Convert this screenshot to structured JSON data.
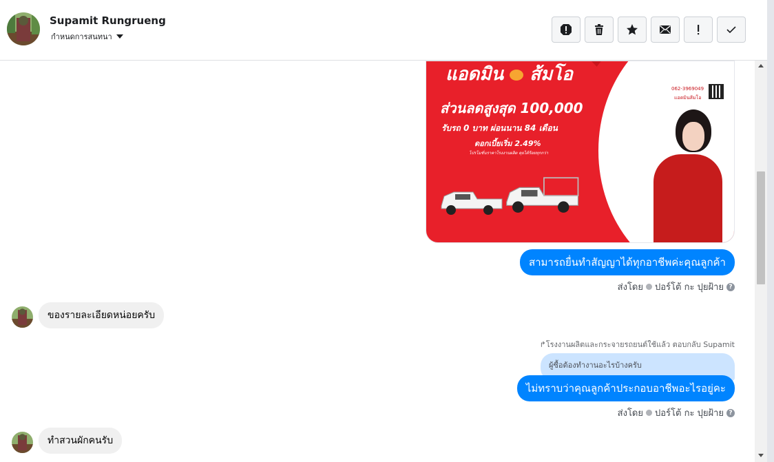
{
  "header": {
    "contact_name": "Supamit Rungrueng",
    "assign_label": "กำหนดการสนทนา",
    "toolbar": {
      "spam": "spam-icon",
      "delete": "trash-icon",
      "star": "star-icon",
      "mark_unread": "envelope-icon",
      "follow_up": "exclamation-icon",
      "done": "check-icon"
    }
  },
  "ad": {
    "brand": "แอดมิน",
    "brand2": "ส้มโอ",
    "headline": "ส่วนลดสูงสุด 100,000",
    "line2": "รับรถ 0 บาท ผ่อนนาน 84 เดือน",
    "line3": "ดอกเบี้ยเริ่ม 2.49%",
    "fine_print": "โปรโมชั่นราคาโรงงานผลิต คุยได้ร้อยทุกกว่า",
    "phone": "062-3969049",
    "contact_name": "แอดมินส้มโอ"
  },
  "messages": [
    {
      "type": "outgoing",
      "text": "สามารถยื่นทำสัญญาได้ทุกอาชีพค่ะคุณลูกค้า"
    },
    {
      "type": "sent_by",
      "prefix": "ส่งโดย",
      "name": "ปอร์โต้ กะ ปุยฝ้าย"
    },
    {
      "type": "incoming",
      "text": "ของรายละเอียดหน่อยครับ"
    },
    {
      "type": "reply_label",
      "text": "โรงงานผลิตและกระจายรถยนต์ใช้แล้ว ตอบกลับ Supamit"
    },
    {
      "type": "quoted",
      "text": "ผู้ซื้อต้องทำงานอะไรบ้างครับ"
    },
    {
      "type": "outgoing",
      "text": "ไม่ทราบว่าคุณลูกค้าประกอบอาชีพอะไรอยู่คะ"
    },
    {
      "type": "sent_by",
      "prefix": "ส่งโดย",
      "name": "ปอร์โต้ กะ ปุยฝ้าย"
    },
    {
      "type": "incoming",
      "text": "ทำสวนผักคนรับ"
    }
  ],
  "colors": {
    "outgoing_bubble": "#0084ff",
    "incoming_bubble": "#f0f0f0",
    "quoted_bubble": "#cce4ff",
    "ad_red": "#e8202a"
  }
}
